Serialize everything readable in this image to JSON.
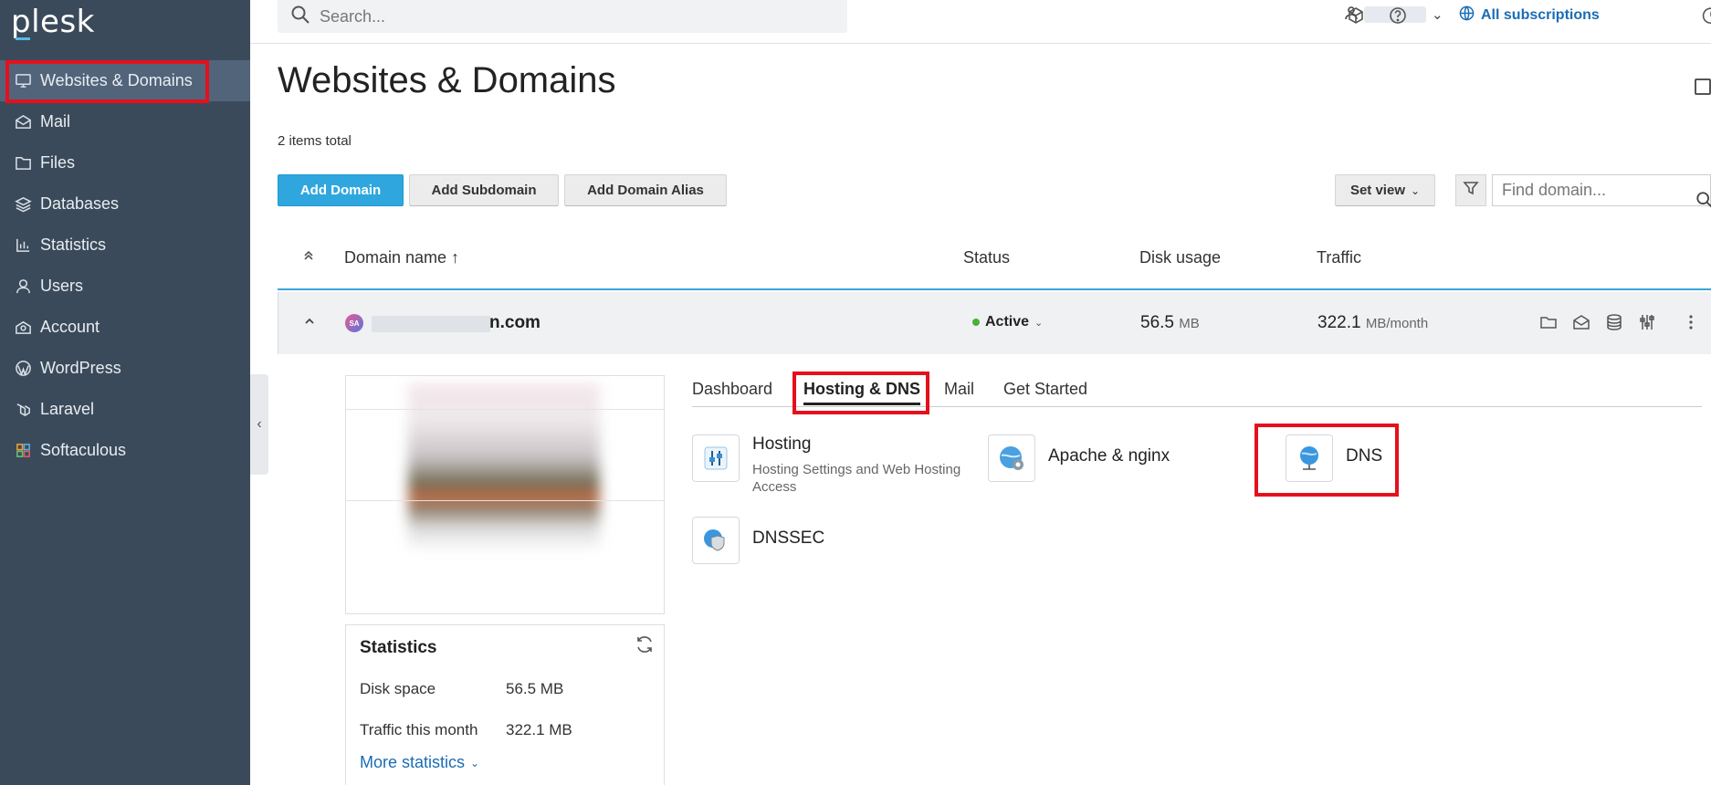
{
  "app": {
    "logo": "plesk"
  },
  "sidebar": {
    "items": [
      {
        "label": "Websites & Domains",
        "icon": "monitor-icon"
      },
      {
        "label": "Mail",
        "icon": "envelope-icon"
      },
      {
        "label": "Files",
        "icon": "folder-icon"
      },
      {
        "label": "Databases",
        "icon": "layers-icon"
      },
      {
        "label": "Statistics",
        "icon": "bar-chart-icon"
      },
      {
        "label": "Users",
        "icon": "user-icon"
      },
      {
        "label": "Account",
        "icon": "account-icon"
      },
      {
        "label": "WordPress",
        "icon": "wordpress-icon"
      },
      {
        "label": "Laravel",
        "icon": "laravel-icon"
      },
      {
        "label": "Softaculous",
        "icon": "softaculous-icon"
      }
    ],
    "active_index": 0,
    "collapse_glyph": "‹"
  },
  "topbar": {
    "search_placeholder": "Search...",
    "subscriptions_label": "All subscriptions",
    "user_chevron": "⌄"
  },
  "page": {
    "title": "Websites & Domains",
    "items_total": "2 items total"
  },
  "toolbar": {
    "add_domain": "Add Domain",
    "add_subdomain": "Add Subdomain",
    "add_domain_alias": "Add Domain Alias",
    "set_view": "Set view",
    "find_placeholder": "Find domain..."
  },
  "table": {
    "columns": {
      "domain": "Domain name ↑",
      "status": "Status",
      "disk": "Disk usage",
      "traffic": "Traffic"
    },
    "row": {
      "favicon_text": "SA",
      "domain_suffix": "n.com",
      "status": "Active",
      "disk_value": "56.5",
      "disk_unit": "MB",
      "traffic_value": "322.1",
      "traffic_unit": "MB/month"
    }
  },
  "details": {
    "tabs": [
      "Dashboard",
      "Hosting & DNS",
      "Mail",
      "Get Started"
    ],
    "active_tab": 1,
    "tools": {
      "hosting": {
        "name": "Hosting",
        "desc": "Hosting Settings and Web Hosting Access"
      },
      "apache": {
        "name": "Apache & nginx"
      },
      "dns": {
        "name": "DNS"
      },
      "dnssec": {
        "name": "DNSSEC"
      }
    },
    "stats": {
      "title": "Statistics",
      "disk_label": "Disk space",
      "disk_value": "56.5 MB",
      "traffic_label": "Traffic this month",
      "traffic_value": "322.1 MB",
      "more": "More statistics"
    }
  },
  "colors": {
    "sidebar_bg": "#3b4a5a",
    "primary": "#2fa7de",
    "link": "#1b6cb5",
    "highlight": "#e5101d",
    "active_status": "#4caf3a"
  }
}
